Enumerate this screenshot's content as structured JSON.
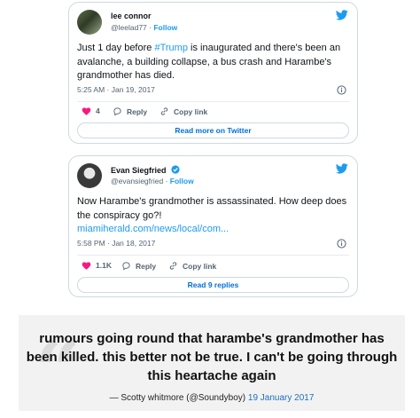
{
  "tweets": [
    {
      "display_name": "lee connor",
      "handle": "@leelad77",
      "follow_label": "Follow",
      "text_before": "Just 1 day before ",
      "hashtag": "#Trump",
      "text_after": " is inaugurated and there's been an avalanche, a building collapse, a bus crash and Harambe's grandmother has died.",
      "timestamp": "5:25 AM · Jan 19, 2017",
      "likes": "4",
      "reply_label": "Reply",
      "copy_label": "Copy link",
      "cta_label": "Read more on Twitter"
    },
    {
      "display_name": "Evan Siegfried",
      "handle": "@evansiegfried",
      "follow_label": "Follow",
      "text": "Now Harambe's grandmother is assassinated. How deep does the conspiracy go?!",
      "link_text": "miamiherald.com/news/local/com...",
      "timestamp": "5:58 PM · Jan 18, 2017",
      "likes": "1.1K",
      "reply_label": "Reply",
      "copy_label": "Copy link",
      "cta_label": "Read 9 replies"
    }
  ],
  "quote": {
    "text": "rumours going round that harambe's grandmother has been killed. this better not be true. I can't be going through this heartache again",
    "attribution": "— Scotty whitmore (@Soundyboy)",
    "date": "19 January 2017"
  },
  "colors": {
    "accent": "#1d9bf0",
    "like": "#f91880",
    "link": "#006fd6"
  }
}
